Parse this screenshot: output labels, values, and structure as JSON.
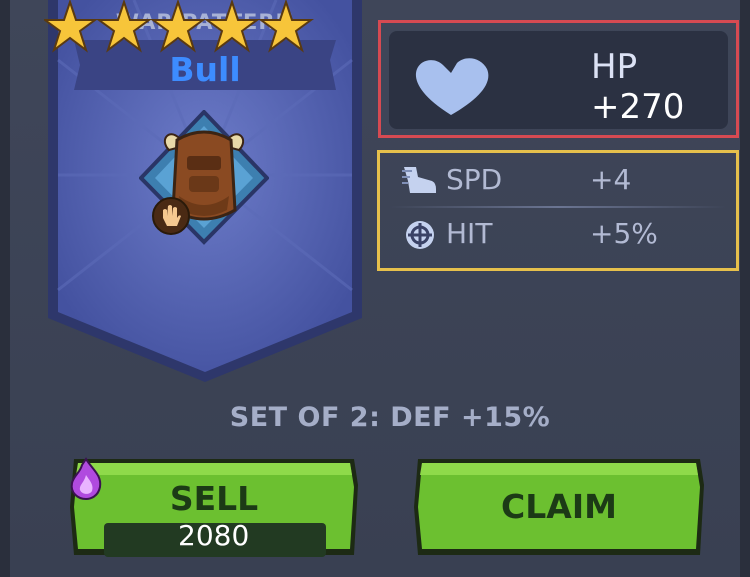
{
  "banner": {
    "subtitle": "WAR PATTERN",
    "name": "Bull",
    "stars": 5,
    "max_stars": 5,
    "icon": "bull-emblem-icon",
    "badge_icon": "hand-icon"
  },
  "main_stat": {
    "icon": "heart-icon",
    "label": "HP",
    "value": "+270"
  },
  "sub_stats": [
    {
      "icon": "boot-icon",
      "label": "SPD",
      "value": "+4"
    },
    {
      "icon": "crosshair-icon",
      "label": "HIT",
      "value": "+5%"
    }
  ],
  "set_bonus": "SET OF 2: DEF +15%",
  "buttons": {
    "sell": {
      "label": "SELL",
      "price": "2080",
      "currency_icon": "purple-flame-gem-icon"
    },
    "claim": {
      "label": "CLAIM"
    }
  },
  "colors": {
    "main_stat_highlight": "#d64a52",
    "sub_stat_highlight": "#e6c04c",
    "button_green": "#6cc030",
    "banner_blue": "#4957a6",
    "name_blue": "#3d8cff"
  }
}
